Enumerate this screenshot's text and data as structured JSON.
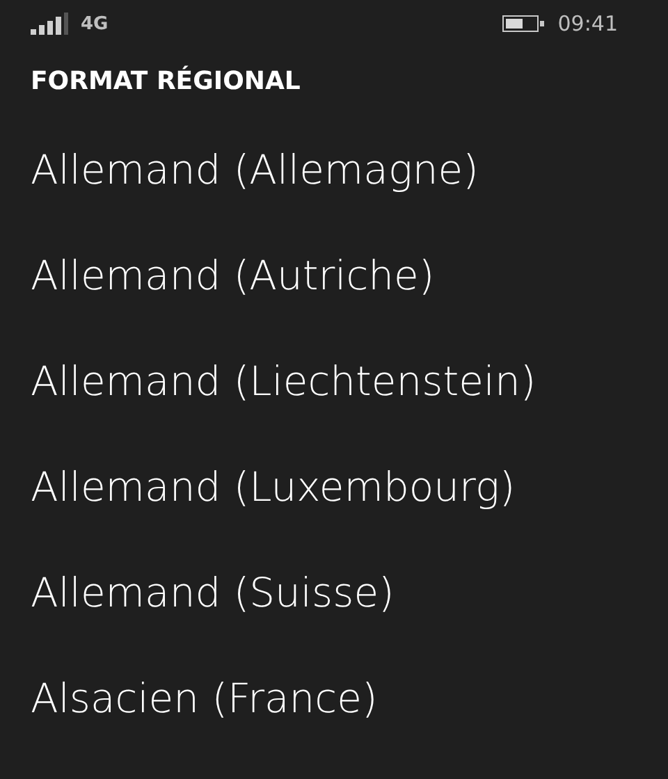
{
  "status_bar": {
    "network": "4G",
    "time": "09:41"
  },
  "title": "FORMAT RÉGIONAL",
  "items": [
    {
      "label": "Allemand (Allemagne)"
    },
    {
      "label": "Allemand (Autriche)"
    },
    {
      "label": "Allemand (Liechtenstein)"
    },
    {
      "label": "Allemand (Luxembourg)"
    },
    {
      "label": "Allemand (Suisse)"
    },
    {
      "label": "Alsacien (France)"
    }
  ]
}
